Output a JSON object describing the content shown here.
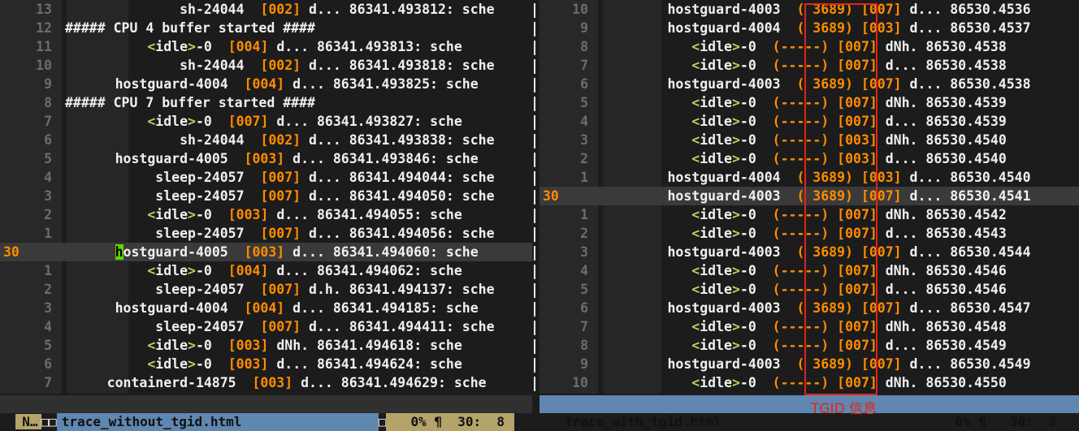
{
  "left": {
    "lines": [
      {
        "num": "13",
        "cur": false,
        "lead": "              ",
        "proc": "sh-24044",
        "pre": "",
        "cpu": "[002]",
        "rest": " d... 86341.493812: sche"
      },
      {
        "num": "12",
        "cur": false,
        "special": "##### CPU 4 buffer started ####"
      },
      {
        "num": "11",
        "cur": false,
        "lead": "          ",
        "idle": true,
        "proc": "",
        "cpu": "[004]",
        "rest": " d... 86341.493813: sche"
      },
      {
        "num": "10",
        "cur": false,
        "lead": "              ",
        "proc": "sh-24044",
        "cpu": "[002]",
        "rest": " d... 86341.493818: sche"
      },
      {
        "num": "9",
        "cur": false,
        "lead": "      ",
        "proc": "hostguard-4004",
        "cpu": "[004]",
        "rest": " d... 86341.493825: sche"
      },
      {
        "num": "8",
        "cur": false,
        "special": "##### CPU 7 buffer started ####"
      },
      {
        "num": "7",
        "cur": false,
        "lead": "          ",
        "idle": true,
        "cpu": "[007]",
        "rest": " d... 86341.493827: sche"
      },
      {
        "num": "6",
        "cur": false,
        "lead": "              ",
        "proc": "sh-24044",
        "cpu": "[002]",
        "rest": " d... 86341.493838: sche"
      },
      {
        "num": "5",
        "cur": false,
        "lead": "      ",
        "proc": "hostguard-4005",
        "cpu": "[003]",
        "rest": " d... 86341.493846: sche"
      },
      {
        "num": "4",
        "cur": false,
        "lead": "           ",
        "proc": "sleep-24057",
        "cpu": "[007]",
        "rest": " d... 86341.494044: sche"
      },
      {
        "num": "3",
        "cur": false,
        "lead": "           ",
        "proc": "sleep-24057",
        "cpu": "[007]",
        "rest": " d... 86341.494050: sche"
      },
      {
        "num": "2",
        "cur": false,
        "lead": "          ",
        "idle": true,
        "cpu": "[003]",
        "rest": " d... 86341.494055: sche"
      },
      {
        "num": "1",
        "cur": false,
        "lead": "           ",
        "proc": "sleep-24057",
        "cpu": "[007]",
        "rest": " d... 86341.494056: sche"
      },
      {
        "num": "30",
        "cur": true,
        "lead": "      ",
        "cursorch": "h",
        "proc": "ostguard-4005",
        "cpu": "[003]",
        "rest": " d... 86341.494060: sche"
      },
      {
        "num": "1",
        "cur": false,
        "lead": "          ",
        "idle": true,
        "cpu": "[004]",
        "rest": " d... 86341.494062: sche"
      },
      {
        "num": "2",
        "cur": false,
        "lead": "           ",
        "proc": "sleep-24057",
        "cpu": "[007]",
        "rest": " d.h. 86341.494137: sche"
      },
      {
        "num": "3",
        "cur": false,
        "lead": "      ",
        "proc": "hostguard-4004",
        "cpu": "[004]",
        "rest": " d... 86341.494185: sche"
      },
      {
        "num": "4",
        "cur": false,
        "lead": "           ",
        "proc": "sleep-24057",
        "cpu": "[007]",
        "rest": " d... 86341.494411: sche"
      },
      {
        "num": "5",
        "cur": false,
        "lead": "          ",
        "idle": true,
        "cpu": "[003]",
        "rest": " dNh. 86341.494618: sche"
      },
      {
        "num": "6",
        "cur": false,
        "lead": "          ",
        "idle": true,
        "cpu": "[003]",
        "rest": " d... 86341.494624: sche"
      },
      {
        "num": "7",
        "cur": false,
        "lead": "     ",
        "proc": "containerd-14875",
        "cpu": "[003]",
        "rest": " d... 86341.494629: sche"
      }
    ],
    "status": {
      "mode": "N…",
      "box": "□□",
      "file": "trace_without_tgid.html",
      "pct": "0% ¶  30:  8"
    }
  },
  "right": {
    "lines": [
      {
        "num": "10",
        "cur": false,
        "lead": "        ",
        "proc": "hostguard-4003",
        "tg": "( 3689)",
        "cpu": "[007]",
        "rest": " d... 86530.4536"
      },
      {
        "num": "9",
        "cur": false,
        "lead": "        ",
        "proc": "hostguard-4004",
        "tg": "( 3689)",
        "cpu": "[003]",
        "rest": " d... 86530.4537"
      },
      {
        "num": "8",
        "cur": false,
        "lead": "           ",
        "idle": true,
        "tg": "(-----)",
        "cpu": "[007]",
        "rest": " dNh. 86530.4538"
      },
      {
        "num": "7",
        "cur": false,
        "lead": "           ",
        "idle": true,
        "tg": "(-----)",
        "cpu": "[007]",
        "rest": " d... 86530.4538"
      },
      {
        "num": "6",
        "cur": false,
        "lead": "        ",
        "proc": "hostguard-4003",
        "tg": "( 3689)",
        "cpu": "[007]",
        "rest": " d... 86530.4538"
      },
      {
        "num": "5",
        "cur": false,
        "lead": "           ",
        "idle": true,
        "tg": "(-----)",
        "cpu": "[007]",
        "rest": " dNh. 86530.4539"
      },
      {
        "num": "4",
        "cur": false,
        "lead": "           ",
        "idle": true,
        "tg": "(-----)",
        "cpu": "[007]",
        "rest": " d... 86530.4539"
      },
      {
        "num": "3",
        "cur": false,
        "lead": "           ",
        "idle": true,
        "tg": "(-----)",
        "cpu": "[003]",
        "rest": " dNh. 86530.4540"
      },
      {
        "num": "2",
        "cur": false,
        "lead": "           ",
        "idle": true,
        "tg": "(-----)",
        "cpu": "[003]",
        "rest": " d... 86530.4540"
      },
      {
        "num": "1",
        "cur": false,
        "lead": "        ",
        "proc": "hostguard-4004",
        "tg": "( 3689)",
        "cpu": "[003]",
        "rest": " d... 86530.4540"
      },
      {
        "num": "30",
        "cur": true,
        "lead": "        ",
        "proc": "hostguard-4003",
        "tg": "( 3689)",
        "cpu": "[007]",
        "rest": " d... 86530.4541"
      },
      {
        "num": "1",
        "cur": false,
        "lead": "           ",
        "idle": true,
        "tg": "(-----)",
        "cpu": "[007]",
        "rest": " dNh. 86530.4542"
      },
      {
        "num": "2",
        "cur": false,
        "lead": "           ",
        "idle": true,
        "tg": "(-----)",
        "cpu": "[007]",
        "rest": " d... 86530.4543"
      },
      {
        "num": "3",
        "cur": false,
        "lead": "        ",
        "proc": "hostguard-4003",
        "tg": "( 3689)",
        "cpu": "[007]",
        "rest": " d... 86530.4544"
      },
      {
        "num": "4",
        "cur": false,
        "lead": "           ",
        "idle": true,
        "tg": "(-----)",
        "cpu": "[007]",
        "rest": " dNh. 86530.4546"
      },
      {
        "num": "5",
        "cur": false,
        "lead": "           ",
        "idle": true,
        "tg": "(-----)",
        "cpu": "[007]",
        "rest": " d... 86530.4546"
      },
      {
        "num": "6",
        "cur": false,
        "lead": "        ",
        "proc": "hostguard-4003",
        "tg": "( 3689)",
        "cpu": "[007]",
        "rest": " d... 86530.4547"
      },
      {
        "num": "7",
        "cur": false,
        "lead": "           ",
        "idle": true,
        "tg": "(-----)",
        "cpu": "[007]",
        "rest": " dNh. 86530.4548"
      },
      {
        "num": "8",
        "cur": false,
        "lead": "           ",
        "idle": true,
        "tg": "(-----)",
        "cpu": "[007]",
        "rest": " d... 86530.4549"
      },
      {
        "num": "9",
        "cur": false,
        "lead": "        ",
        "proc": "hostguard-4003",
        "tg": "( 3689)",
        "cpu": "[007]",
        "rest": " d... 86530.4549"
      },
      {
        "num": "10",
        "cur": false,
        "lead": "           ",
        "idle": true,
        "tg": "(-----)",
        "cpu": "[007]",
        "rest": " dNh. 86530.4550"
      }
    ],
    "status": {
      "file": "trace_with_tgid.html",
      "pct": "0% ¶   30:  8"
    }
  },
  "idle_text": {
    "open": "<",
    "word": "idle",
    "close": ">",
    "suffix": "-0"
  },
  "annotation": "TGID 信息"
}
